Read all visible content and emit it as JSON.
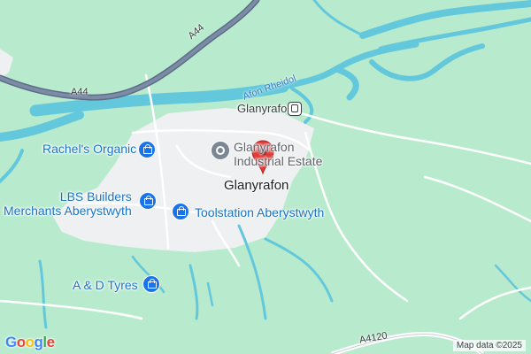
{
  "map": {
    "colors": {
      "land": "#b8ebcd",
      "urban": "#eef0f1",
      "water": "#64c8dc",
      "highway": "#6f7f97",
      "minor_road": "#ffffff",
      "marker": "#e53935",
      "poi_blue": "#1a73e8"
    },
    "roads": {
      "a44_top": "A44",
      "a44_left": "A44",
      "a4120": "A4120"
    },
    "river": "Afon Rheidol",
    "station": {
      "label": "Glanyrafon",
      "icon": "train-station-icon"
    },
    "town": "Glanyrafon",
    "pois": {
      "rachels_organic": {
        "label": "Rachel's Organic",
        "icon": "shopping-bag-icon"
      },
      "industrial_estate": {
        "line1": "Glanyrafon",
        "line2": "Industrial Estate",
        "icon": "gear-icon"
      },
      "lbs_builders": {
        "line1": "LBS Builders",
        "line2": "Merchants Aberystwyth",
        "icon": "shopping-bag-icon"
      },
      "toolstation": {
        "label": "Toolstation Aberystwyth",
        "icon": "shopping-bag-icon"
      },
      "ad_tyres": {
        "label": "A & D Tyres",
        "icon": "shopping-bag-icon"
      }
    },
    "marker": "red-location-pin",
    "logo": {
      "letters": [
        "G",
        "o",
        "o",
        "g",
        "l",
        "e"
      ],
      "colors": [
        "#4285f4",
        "#ea4335",
        "#fbbc05",
        "#4285f4",
        "#34a853",
        "#ea4335"
      ]
    },
    "attribution": "Map data ©2025"
  }
}
